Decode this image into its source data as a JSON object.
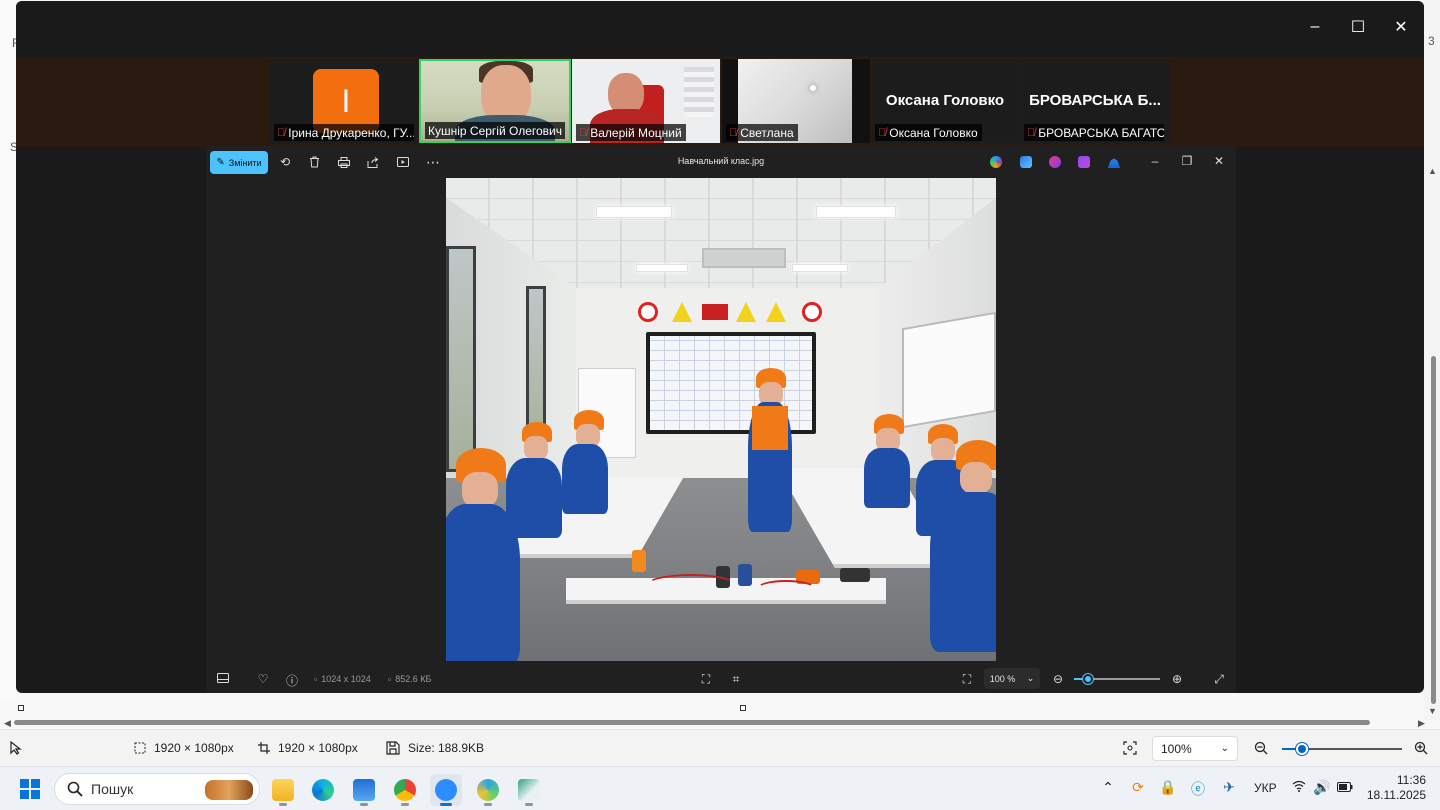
{
  "paint": {
    "left_chars": [
      "F",
      "S"
    ],
    "right_chars": [
      "3"
    ],
    "status": {
      "selection_size": "1920 × 1080px",
      "canvas_size": "1920 × 1080px",
      "file_size": "Size: 188.9KB",
      "zoom": "100%",
      "zoom_level_fraction": 0.15
    }
  },
  "zoom_meeting": {
    "window_controls": {
      "minimize": "–",
      "maximize": "☐",
      "close": "✕"
    },
    "participants": [
      {
        "name": "Ірина Друкаренко, ГУ...",
        "avatar_letter": "I",
        "muted": true,
        "video": false,
        "active": false
      },
      {
        "name": "Кушнір Сергій Олегович",
        "muted": false,
        "video": true,
        "active": true
      },
      {
        "name": "Валерій Моцний",
        "muted": true,
        "video": true,
        "active": false
      },
      {
        "name": "Светлана",
        "muted": true,
        "video": true,
        "active": false
      },
      {
        "name": "Оксана Головко",
        "display_name": "Оксана Головко",
        "muted": true,
        "video": false,
        "active": false
      },
      {
        "name": "БРОВАРСЬКА БАГАТО...",
        "display_name": "БРОВАРСЬКА Б...",
        "muted": true,
        "video": false,
        "active": false
      }
    ]
  },
  "photos": {
    "edit_label": "Змінити",
    "title": "Навчальний клас.jpg",
    "dimensions": "1024 x 1024",
    "file_size": "852.6 КБ",
    "zoom": "100 %",
    "zoom_fraction": 0.12,
    "toolbar_icons": [
      "rotate-icon",
      "delete-icon",
      "print-icon",
      "share-icon",
      "slideshow-icon",
      "more-icon"
    ],
    "app_icons": [
      "copilot-icon",
      "clipchamp-icon",
      "designer-icon",
      "clipchamp-video-icon",
      "onedrive-icon"
    ]
  },
  "colors": {
    "accent_green": "#2fd36a",
    "edit_blue": "#4cc2ff",
    "windows_blue": "#0a74da",
    "mute_red": "#e23b3b"
  },
  "taskbar": {
    "search_placeholder": "Пошук",
    "apps": [
      "file-explorer",
      "edge",
      "notepad",
      "chrome",
      "zoom",
      "paint-app",
      "screen-app"
    ],
    "language": "УКР",
    "time": "11:36",
    "date": "18.11.2025"
  }
}
